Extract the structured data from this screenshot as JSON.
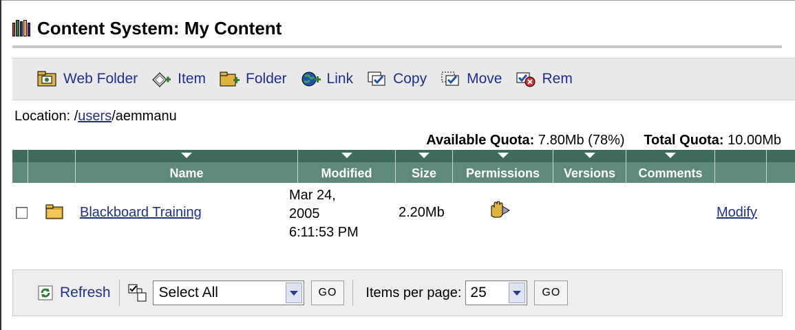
{
  "title": "Content System: My Content",
  "toolbar": {
    "items": [
      {
        "label": "Web Folder",
        "icon": "web-folder-icon"
      },
      {
        "label": "Item",
        "icon": "add-item-icon"
      },
      {
        "label": "Folder",
        "icon": "add-folder-icon"
      },
      {
        "label": "Link",
        "icon": "add-link-icon"
      },
      {
        "label": "Copy",
        "icon": "copy-icon"
      },
      {
        "label": "Move",
        "icon": "move-icon"
      },
      {
        "label": "Rem",
        "icon": "remove-icon"
      }
    ]
  },
  "location": {
    "prefix": "Location: /",
    "link": "users",
    "suffix": "/aemmanu"
  },
  "quota": {
    "available_label": "Available Quota:",
    "available_value": "7.80Mb (78%)",
    "total_label": "Total Quota:",
    "total_value": "10.00Mb"
  },
  "table": {
    "headers": [
      "Name",
      "Modified",
      "Size",
      "Permissions",
      "Versions",
      "Comments"
    ],
    "rows": [
      {
        "name": "Blackboard Training",
        "modified_line1": "Mar 24,",
        "modified_line2": "2005",
        "modified_line3": "6:11:53 PM",
        "size": "2.20Mb",
        "action": "Modify"
      }
    ]
  },
  "bottombar": {
    "refresh": "Refresh",
    "select_value": "Select All",
    "go1": "GO",
    "items_per_page_label": "Items per page:",
    "items_per_page_value": "25",
    "go2": "GO"
  },
  "colors": {
    "header_bg": "#5e8a7e",
    "header_arrow_bg": "#3f6b5f",
    "link": "#1f2f8f",
    "toolbar_bg": "#e9e9e9"
  }
}
